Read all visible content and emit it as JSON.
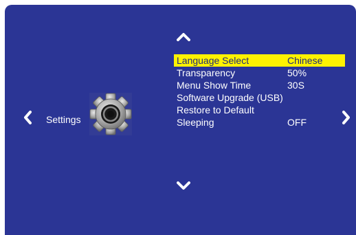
{
  "page": {
    "title": "Settings"
  },
  "menu": {
    "items": [
      {
        "label": "Language Select",
        "value": "Chinese",
        "selected": true
      },
      {
        "label": "Transparency",
        "value": "50%",
        "selected": false
      },
      {
        "label": "Menu Show Time",
        "value": "30S",
        "selected": false
      },
      {
        "label": "Software Upgrade (USB)",
        "value": "",
        "selected": false
      },
      {
        "label": "Restore to Default",
        "value": "",
        "selected": false
      },
      {
        "label": "Sleeping",
        "value": "OFF",
        "selected": false
      }
    ]
  },
  "icons": {
    "left": "chevron-left-icon",
    "right": "chevron-right-icon",
    "up": "chevron-up-icon",
    "down": "chevron-down-icon",
    "category": "gear-icon"
  },
  "colors": {
    "background": "#2b3595",
    "highlight": "#fff200",
    "text": "#ffffff",
    "highlight_text": "#1f2a7a"
  }
}
